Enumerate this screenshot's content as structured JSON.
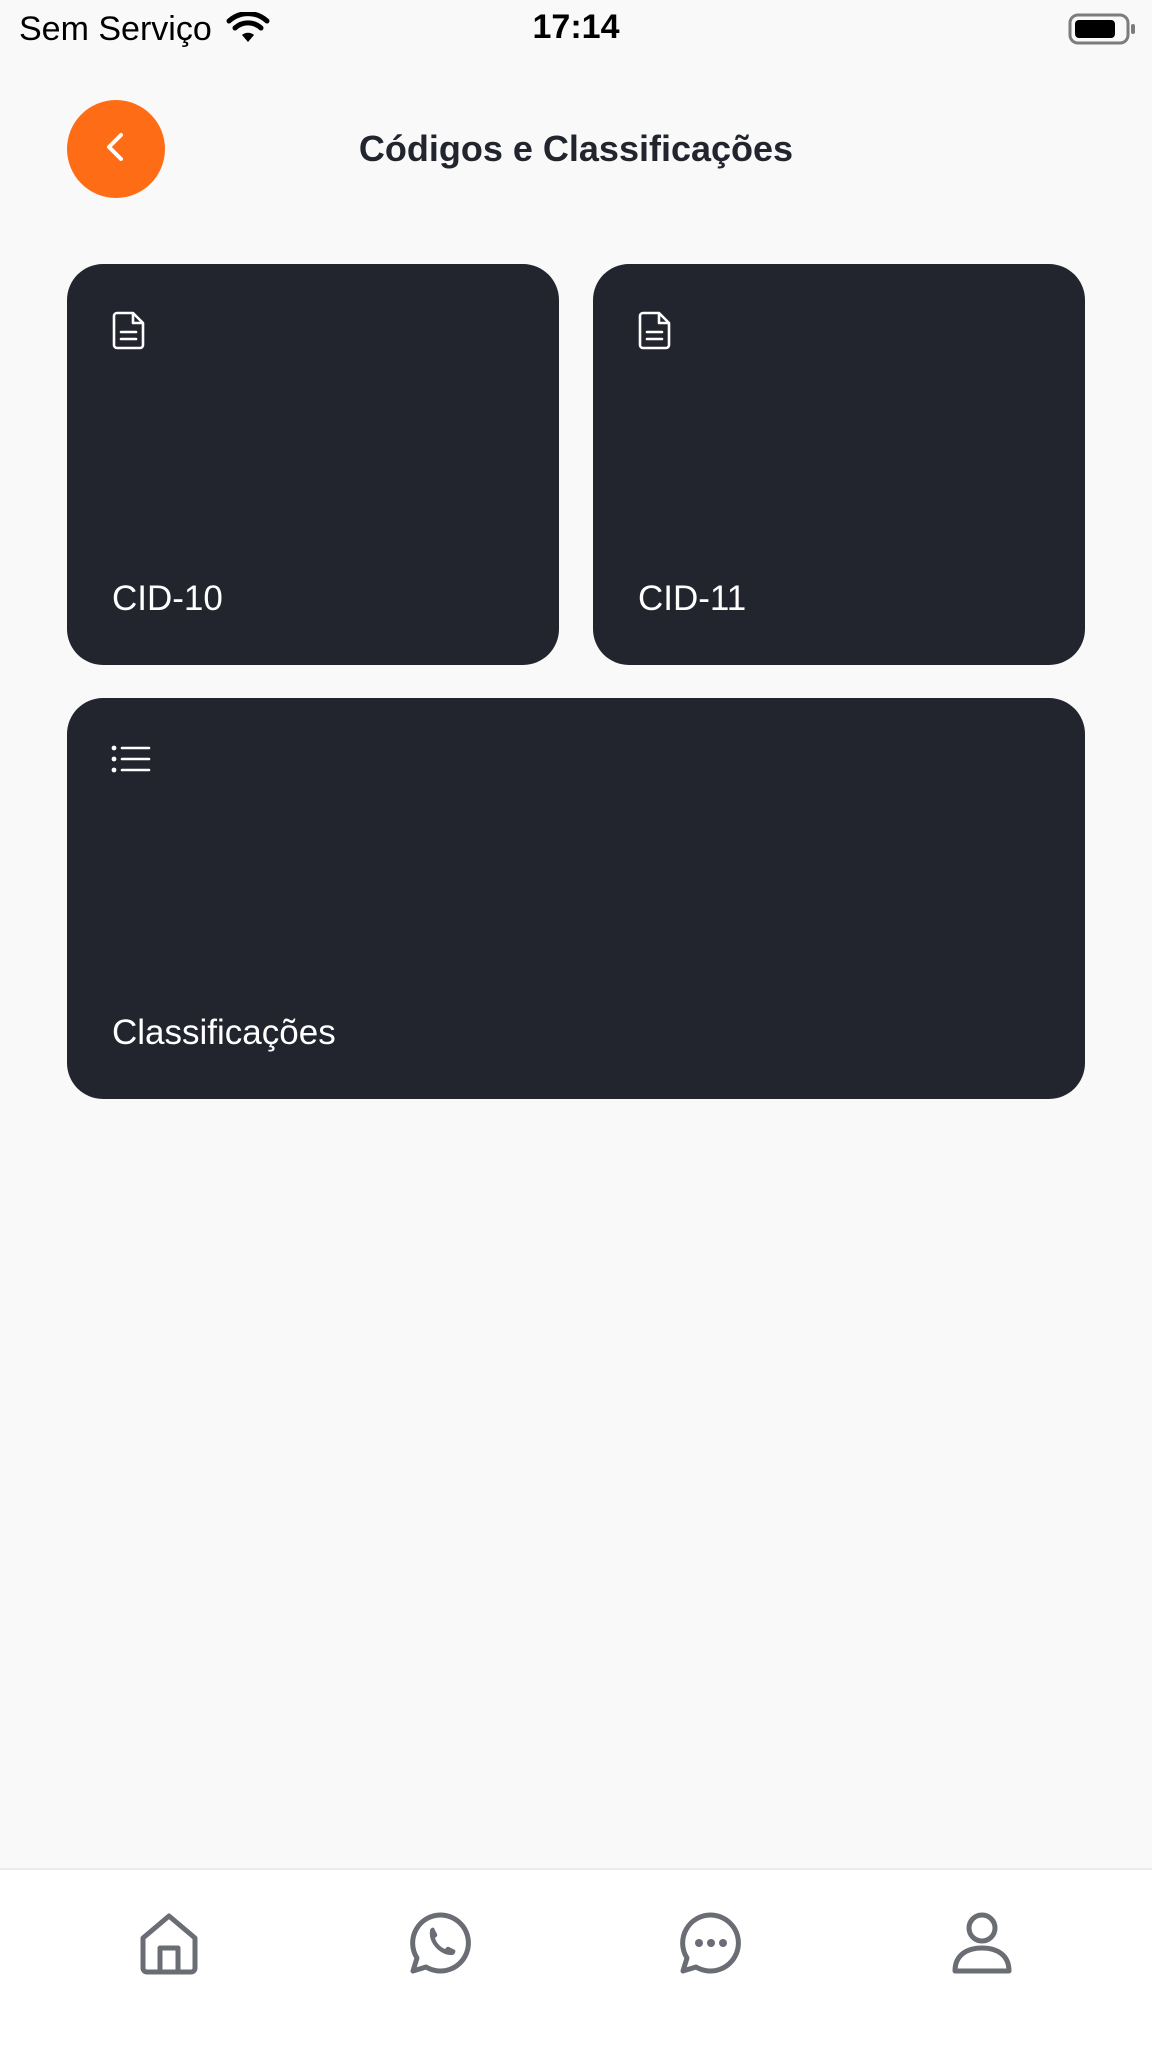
{
  "status_bar": {
    "carrier": "Sem Serviço",
    "time": "17:14",
    "icons": [
      "wifi-icon",
      "battery-icon"
    ]
  },
  "header": {
    "title": "Códigos e Classificações",
    "back_icon": "chevron-left-icon"
  },
  "cards": [
    {
      "label": "CID-10",
      "icon": "document-icon"
    },
    {
      "label": "CID-11",
      "icon": "document-icon"
    },
    {
      "label": "Classificações",
      "icon": "list-icon"
    }
  ],
  "tab_bar": {
    "items": [
      {
        "icon": "home-icon"
      },
      {
        "icon": "whatsapp-icon"
      },
      {
        "icon": "chat-icon"
      },
      {
        "icon": "user-icon"
      }
    ]
  },
  "colors": {
    "accent": "#ff6c16",
    "card_background": "#22252d",
    "page_background": "#f9f9f9",
    "tab_icon": "#6b6d74"
  }
}
